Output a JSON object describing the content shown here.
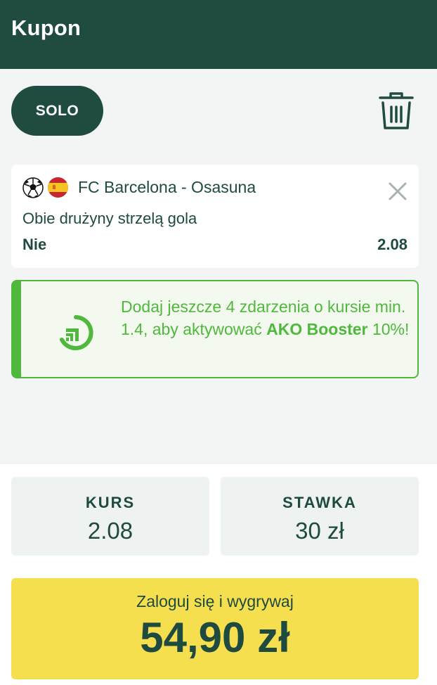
{
  "header": {
    "title": "Kupon"
  },
  "toolbar": {
    "mode_label": "SOLO",
    "delete_icon": "trash-icon"
  },
  "bet": {
    "sport_icon": "soccer-ball-icon",
    "flag_icon": "spain-flag-icon",
    "match": "FC Barcelona - Osasuna",
    "market": "Obie drużyny strzelą gola",
    "selection": "Nie",
    "odd": "2.08"
  },
  "booster": {
    "text_part1": "Dodaj jeszcze 4 zdarzenia o kursie min. 1.4, aby aktywować ",
    "text_bold": "AKO Booster",
    "text_part2": " 10%!",
    "accent_color": "#4fb83d"
  },
  "summary": {
    "kurs_label": "KURS",
    "kurs_value": "2.08",
    "stawka_label": "STAWKA",
    "stawka_value": "30 zł"
  },
  "win": {
    "label": "Zaloguj się i wygrywaj",
    "amount": "54,90 zł"
  },
  "colors": {
    "primary": "#1f4b40",
    "accent_green": "#4fb83d",
    "win_yellow": "#f6df4f"
  }
}
